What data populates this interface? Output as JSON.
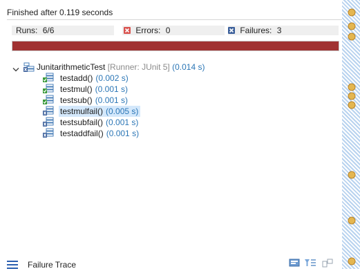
{
  "status": {
    "text": "Finished after 0.119 seconds"
  },
  "counters": {
    "runs_label": "Runs:",
    "runs_value": "6/6",
    "errors_label": "Errors:",
    "errors_value": "0",
    "failures_label": "Failures:",
    "failures_value": "3"
  },
  "progress": {
    "color": "#a03232",
    "fraction": 1.0
  },
  "tree": {
    "root": {
      "name": "JunitarithmeticTest",
      "runner": "[Runner: JUnit 5]",
      "time": "(0.014 s)",
      "icon": "test-suite-failed-icon"
    },
    "tests": [
      {
        "name": "testadd()",
        "time": "(0.002 s)",
        "icon": "test-passed-icon",
        "selected": false
      },
      {
        "name": "testmul()",
        "time": "(0.001 s)",
        "icon": "test-passed-icon",
        "selected": false
      },
      {
        "name": "testsub()",
        "time": "(0.001 s)",
        "icon": "test-passed-icon",
        "selected": false
      },
      {
        "name": "testmulfail()",
        "time": "(0.005 s)",
        "icon": "test-failed-icon",
        "selected": true
      },
      {
        "name": "testsubfail()",
        "time": "(0.001 s)",
        "icon": "test-failed-icon",
        "selected": false
      },
      {
        "name": "testaddfail()",
        "time": "(0.001 s)",
        "icon": "test-failed-icon",
        "selected": false
      }
    ]
  },
  "footer": {
    "failure_trace_label": "Failure Trace"
  },
  "colors": {
    "failure_bar": "#a03232",
    "time_text": "#2b76b6",
    "runner_text": "#8b8b8b",
    "selection": "#d4e8fb"
  }
}
